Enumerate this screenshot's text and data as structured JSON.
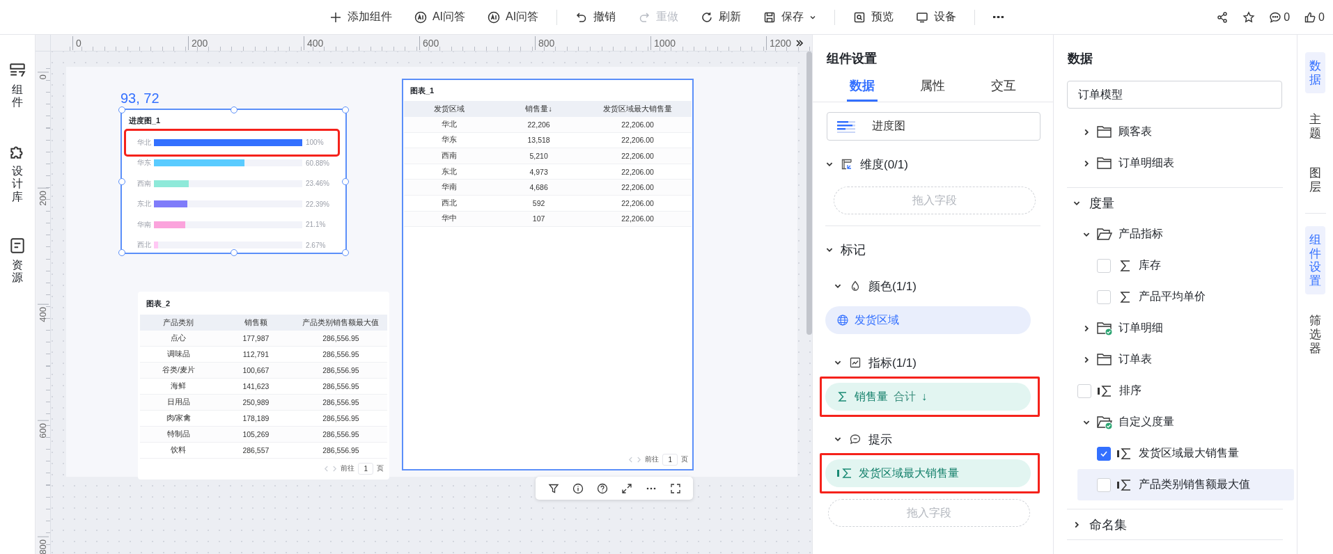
{
  "toolbar": {
    "groups": [
      [
        {
          "kind": "add",
          "label": "添加组件",
          "disabled": false
        },
        {
          "kind": "ai",
          "label": "AI问答",
          "disabled": false
        },
        {
          "kind": "ai",
          "label": "AI问答",
          "disabled": false
        }
      ],
      [
        {
          "kind": "undo",
          "label": "撤销",
          "disabled": false
        },
        {
          "kind": "redo",
          "label": "重做",
          "disabled": true
        },
        {
          "kind": "refresh",
          "label": "刷新",
          "disabled": false
        },
        {
          "kind": "save",
          "label": "保存",
          "disabled": false
        }
      ],
      [
        {
          "kind": "preview",
          "label": "预览",
          "disabled": false
        },
        {
          "kind": "device",
          "label": "设备",
          "disabled": false
        }
      ],
      [
        {
          "kind": "more",
          "disabled": false
        }
      ]
    ],
    "actions": [
      {
        "kind": "share"
      },
      {
        "kind": "star"
      },
      {
        "kind": "comment",
        "count": "0"
      },
      {
        "kind": "like",
        "count": "0"
      }
    ]
  },
  "sidebar": [
    {
      "kind": "components",
      "label": "组件"
    },
    {
      "kind": "library",
      "label": "设计库"
    },
    {
      "kind": "resources",
      "label": "资源"
    }
  ],
  "canvas": {
    "ruler": {
      "x_ticks": [
        "0",
        "200",
        "400",
        "600",
        "800",
        "1000",
        "1200"
      ],
      "y_ticks": [
        "0",
        "200",
        "400",
        "600",
        "800"
      ]
    },
    "position": "93, 72",
    "progress_chart": {
      "title": "进度图_1",
      "selected": true,
      "rows": [
        {
          "label": "华北",
          "level": 1.0,
          "reading": "100%",
          "color": "#3370ff",
          "highlighted": true
        },
        {
          "label": "华东",
          "level": 0.6088,
          "reading": "60.88%",
          "color": "#5acbff",
          "highlighted": false
        },
        {
          "label": "西南",
          "level": 0.2346,
          "reading": "23.46%",
          "color": "#8ee9d9",
          "highlighted": false
        },
        {
          "label": "东北",
          "level": 0.2239,
          "reading": "22.39%",
          "color": "#7f7cfa",
          "highlighted": false
        },
        {
          "label": "华南",
          "level": 0.211,
          "reading": "21.1%",
          "color": "#fba3dc",
          "highlighted": false
        },
        {
          "label": "西北",
          "level": 0.0267,
          "reading": "2.67%",
          "color": "#ffc8f4",
          "highlighted": false
        }
      ]
    },
    "tables": [
      {
        "title": "图表_2",
        "selected": false,
        "columns": [
          {
            "label": "产品类别"
          },
          {
            "label": "销售额"
          },
          {
            "label": "产品类别销售额最大值"
          }
        ],
        "rows": [
          [
            "点心",
            "177,987",
            "286,556.95"
          ],
          [
            "调味品",
            "112,791",
            "286,556.95"
          ],
          [
            "谷类/麦片",
            "100,667",
            "286,556.95"
          ],
          [
            "海鲜",
            "141,623",
            "286,556.95"
          ],
          [
            "日用品",
            "250,989",
            "286,556.95"
          ],
          [
            "肉/家禽",
            "178,189",
            "286,556.95"
          ],
          [
            "特制品",
            "105,269",
            "286,556.95"
          ],
          [
            "饮料",
            "286,557",
            "286,556.95"
          ]
        ],
        "pager": {
          "goto": "前往",
          "page": "1",
          "unit": "页"
        }
      },
      {
        "title": "图表_1",
        "selected": true,
        "columns": [
          {
            "label": "发货区域"
          },
          {
            "label": "销售量",
            "sort_mark": "↓"
          },
          {
            "label": "发货区域最大销售量"
          }
        ],
        "rows": [
          [
            "华北",
            "22,206",
            "22,206.00"
          ],
          [
            "华东",
            "13,518",
            "22,206.00"
          ],
          [
            "西南",
            "5,210",
            "22,206.00"
          ],
          [
            "东北",
            "4,973",
            "22,206.00"
          ],
          [
            "华南",
            "4,686",
            "22,206.00"
          ],
          [
            "西北",
            "592",
            "22,206.00"
          ],
          [
            "华中",
            "107",
            "22,206.00"
          ]
        ],
        "pager": {
          "goto": "前往",
          "page": "1",
          "unit": "页"
        }
      }
    ]
  },
  "settings": {
    "title": "组件设置",
    "tabs": [
      {
        "label": "数据",
        "selected": true
      },
      {
        "label": "属性",
        "selected": false
      },
      {
        "label": "交互",
        "selected": false
      }
    ],
    "chart_type": "进度图",
    "sections": [
      {
        "kind": "dimension",
        "label": "维度",
        "count": "(0/1)",
        "expanded": true,
        "drop": "拖入字段"
      },
      {
        "kind": "marks",
        "label": "标记",
        "expanded": true,
        "children": [
          {
            "kind": "color",
            "label": "颜色",
            "count": "(1/1)",
            "expanded": true,
            "fields": [
              {
                "kind": "dimension",
                "label": "发货区域",
                "highlighted": false
              }
            ]
          },
          {
            "kind": "metric",
            "label": "指标",
            "count": "(1/1)",
            "expanded": true,
            "fields": [
              {
                "kind": "measure",
                "label": "销售量",
                "aggregate": "合计",
                "sort_mark": "↓",
                "highlighted": true
              }
            ]
          },
          {
            "kind": "tooltip",
            "label": "提示",
            "expanded": true,
            "fields": [
              {
                "kind": "calc_measure",
                "label": "发货区域最大销售量",
                "highlighted": true
              }
            ],
            "drop": "拖入字段"
          }
        ]
      }
    ]
  },
  "data": {
    "title": "数据",
    "model": "订单模型",
    "tree": [
      {
        "kind": "folder",
        "label": "顾客表",
        "expanded": false
      },
      {
        "kind": "folder",
        "label": "订单明细表",
        "expanded": false
      },
      {
        "kind": "group",
        "label": "度量",
        "expanded": true,
        "children": [
          {
            "kind": "folder",
            "label": "产品指标",
            "expanded": true,
            "children": [
              {
                "kind": "measure",
                "label": "库存",
                "checked": false,
                "selected": false
              },
              {
                "kind": "measure",
                "label": "产品平均单价",
                "checked": false,
                "selected": false
              }
            ]
          },
          {
            "kind": "linked_folder",
            "label": "订单明细",
            "expanded": false
          },
          {
            "kind": "folder",
            "label": "订单表",
            "expanded": false
          },
          {
            "kind": "calc_measure",
            "label": "排序",
            "checked": false,
            "selected": false
          },
          {
            "kind": "linked_folder",
            "label": "自定义度量",
            "expanded": true,
            "children": [
              {
                "kind": "calc_measure",
                "label": "发货区域最大销售量",
                "checked": true,
                "selected": false
              },
              {
                "kind": "calc_measure",
                "label": "产品类别销售额最大值",
                "checked": false,
                "selected": true
              }
            ]
          }
        ]
      },
      {
        "kind": "group",
        "label": "命名集",
        "expanded": false
      }
    ]
  },
  "side_tabs": [
    [
      {
        "label": "数据",
        "selected": true
      },
      {
        "label": "主题",
        "selected": false
      },
      {
        "label": "图层",
        "selected": false
      }
    ],
    [
      {
        "label": "组件设置",
        "selected": true
      },
      {
        "label": "筛选器",
        "selected": false
      }
    ]
  ]
}
